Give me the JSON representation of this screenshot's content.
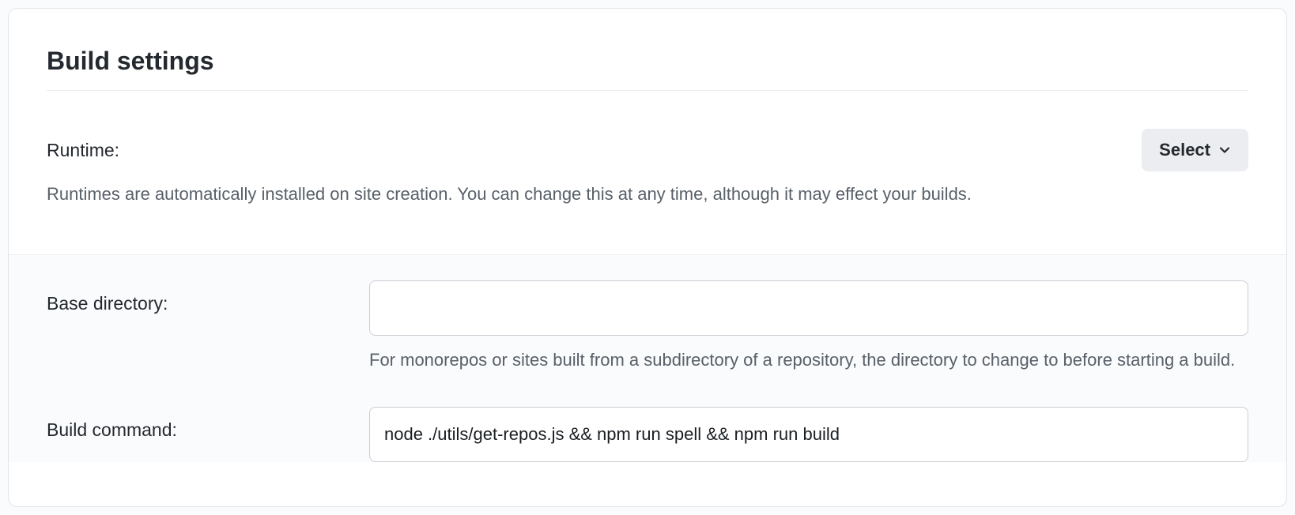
{
  "title": "Build settings",
  "runtime": {
    "label": "Runtime:",
    "select_label": "Select",
    "help": "Runtimes are automatically installed on site creation. You can change this at any time, although it may effect your builds."
  },
  "base_directory": {
    "label": "Base directory:",
    "value": "",
    "help": "For monorepos or sites built from a subdirectory of a repository, the directory to change to before starting a build."
  },
  "build_command": {
    "label": "Build command:",
    "value": "node ./utils/get-repos.js && npm run spell && npm run build"
  }
}
